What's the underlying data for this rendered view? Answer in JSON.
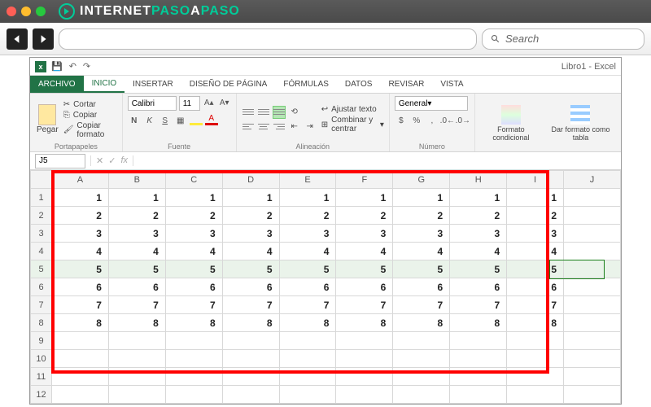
{
  "browser": {
    "logo_text_1": "INTERNET",
    "logo_text_2": "PASO",
    "logo_text_3": "A",
    "logo_text_4": "PASO",
    "search_placeholder": "Search"
  },
  "titlebar": {
    "text": "Libro1 - Excel",
    "excel_glyph": "x"
  },
  "tabs": {
    "file": "ARCHIVO",
    "inicio": "INICIO",
    "insertar": "INSERTAR",
    "diseno": "DISEÑO DE PÁGINA",
    "formulas": "FÓRMULAS",
    "datos": "DATOS",
    "revisar": "REVISAR",
    "vista": "VISTA"
  },
  "ribbon": {
    "clipboard": {
      "paste": "Pegar",
      "cut": "Cortar",
      "copy": "Copiar",
      "format_painter": "Copiar formato",
      "label": "Portapapeles"
    },
    "font": {
      "name": "Calibri",
      "size": "11",
      "bold": "N",
      "italic": "K",
      "underline": "S",
      "a_glyph": "A",
      "label": "Fuente"
    },
    "alignment": {
      "wrap": "Ajustar texto",
      "merge": "Combinar y centrar",
      "label": "Alineación"
    },
    "number": {
      "format": "General",
      "label": "Número"
    },
    "styles": {
      "cond": "Formato condicional",
      "table": "Dar formato como tabla"
    }
  },
  "formula_bar": {
    "name_box": "J5",
    "fx": "fx"
  },
  "grid": {
    "columns": [
      "A",
      "B",
      "C",
      "D",
      "E",
      "F",
      "G",
      "H",
      "I",
      "J"
    ],
    "row_numbers": [
      "1",
      "2",
      "3",
      "4",
      "5",
      "6",
      "7",
      "8",
      "9",
      "10",
      "11",
      "12"
    ],
    "selected_row": 5,
    "data": [
      [
        "1",
        "1",
        "1",
        "1",
        "1",
        "1",
        "1",
        "1",
        "1",
        ""
      ],
      [
        "2",
        "2",
        "2",
        "2",
        "2",
        "2",
        "2",
        "2",
        "2",
        ""
      ],
      [
        "3",
        "3",
        "3",
        "3",
        "3",
        "3",
        "3",
        "3",
        "3",
        ""
      ],
      [
        "4",
        "4",
        "4",
        "4",
        "4",
        "4",
        "4",
        "4",
        "4",
        ""
      ],
      [
        "5",
        "5",
        "5",
        "5",
        "5",
        "5",
        "5",
        "5",
        "5",
        ""
      ],
      [
        "6",
        "6",
        "6",
        "6",
        "6",
        "6",
        "6",
        "6",
        "6",
        ""
      ],
      [
        "7",
        "7",
        "7",
        "7",
        "7",
        "7",
        "7",
        "7",
        "7",
        ""
      ],
      [
        "8",
        "8",
        "8",
        "8",
        "8",
        "8",
        "8",
        "8",
        "8",
        ""
      ],
      [
        "",
        "",
        "",
        "",
        "",
        "",
        "",
        "",
        "",
        ""
      ],
      [
        "",
        "",
        "",
        "",
        "",
        "",
        "",
        "",
        "",
        ""
      ],
      [
        "",
        "",
        "",
        "",
        "",
        "",
        "",
        "",
        "",
        ""
      ],
      [
        "",
        "",
        "",
        "",
        "",
        "",
        "",
        "",
        "",
        ""
      ]
    ]
  }
}
